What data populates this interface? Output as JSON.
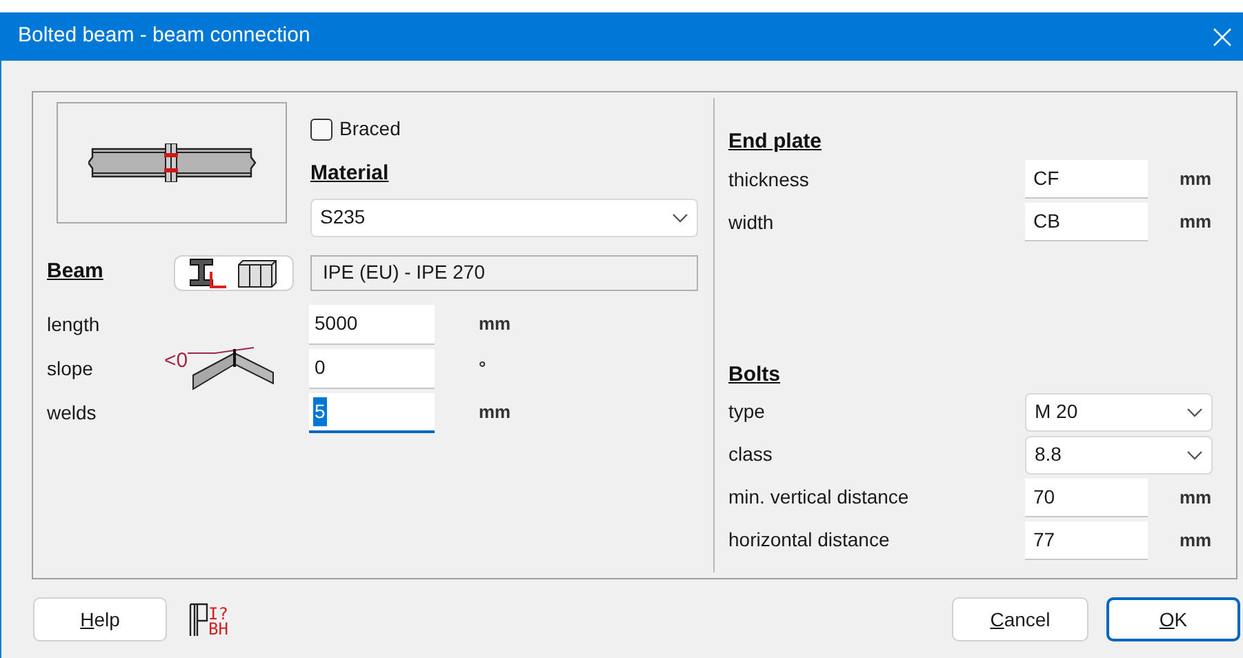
{
  "window": {
    "title": "Bolted beam - beam connection"
  },
  "braced": {
    "label": "Braced",
    "checked": false
  },
  "material": {
    "heading": "Material",
    "value": "S235"
  },
  "beam": {
    "heading": "Beam",
    "profile": "IPE (EU) - IPE 270"
  },
  "slope_hint": "<0",
  "beam_fields": [
    {
      "label": "length",
      "value": "5000",
      "unit": "mm",
      "focused": false
    },
    {
      "label": "slope",
      "value": "0",
      "unit": "°",
      "focused": false
    },
    {
      "label": "welds",
      "value": "5",
      "unit": "mm",
      "focused": true
    }
  ],
  "end_plate": {
    "heading": "End plate",
    "fields": [
      {
        "kind": "input",
        "label": "thickness",
        "value": "CF",
        "unit": "mm"
      },
      {
        "kind": "input",
        "label": "width",
        "value": "CB",
        "unit": "mm"
      }
    ]
  },
  "bolts": {
    "heading": "Bolts",
    "fields": [
      {
        "kind": "select",
        "label": "type",
        "value": "M 20"
      },
      {
        "kind": "select",
        "label": "class",
        "value": "8.8"
      },
      {
        "kind": "input",
        "label": "min. vertical distance",
        "value": "70",
        "unit": "mm"
      },
      {
        "kind": "input",
        "label": "horizontal distance",
        "value": "77",
        "unit": "mm"
      }
    ]
  },
  "help_icon": {
    "top": "I?",
    "bottom": "BH"
  },
  "buttons": [
    {
      "label": "Help",
      "default": false
    },
    {
      "label": "Cancel",
      "default": false
    },
    {
      "label": "OK",
      "default": true
    }
  ]
}
